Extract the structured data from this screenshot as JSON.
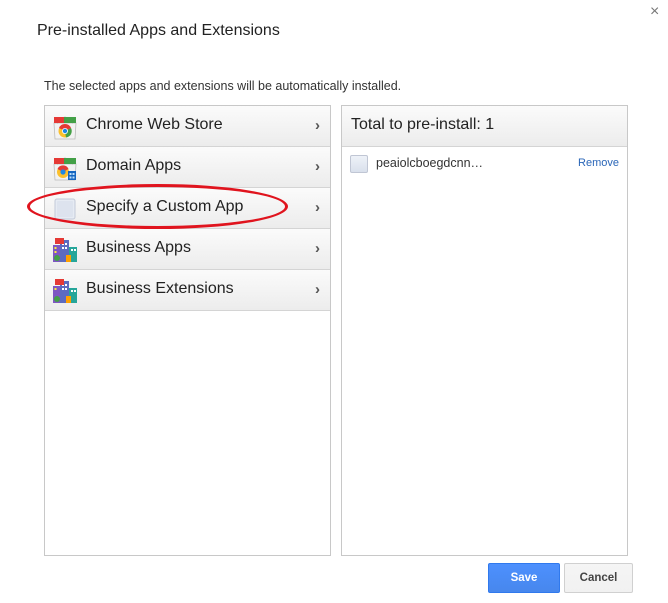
{
  "dialog": {
    "title": "Pre-installed Apps and Extensions",
    "close_glyph": "×",
    "subtitle": "The selected apps and extensions will be automatically installed."
  },
  "categories": [
    {
      "label": "Chrome Web Store",
      "icon": "chrome-web-store-icon",
      "chevron": "›"
    },
    {
      "label": "Domain Apps",
      "icon": "domain-apps-icon",
      "chevron": "›"
    },
    {
      "label": "Specify a Custom App",
      "icon": "custom-app-icon",
      "chevron": "›",
      "highlighted": true
    },
    {
      "label": "Business Apps",
      "icon": "business-apps-icon",
      "chevron": "›"
    },
    {
      "label": "Business Extensions",
      "icon": "business-extensions-icon",
      "chevron": "›"
    }
  ],
  "selection": {
    "total_label": "Total to pre-install: 1",
    "items": [
      {
        "name": "peaiolcboegdcnn…",
        "remove_label": "Remove",
        "icon": "app-placeholder-icon"
      }
    ]
  },
  "buttons": {
    "save": "Save",
    "cancel": "Cancel"
  },
  "colors": {
    "primary_button": "#4d90fe",
    "link": "#2a66b8",
    "highlight_annotation": "#e0141e"
  }
}
